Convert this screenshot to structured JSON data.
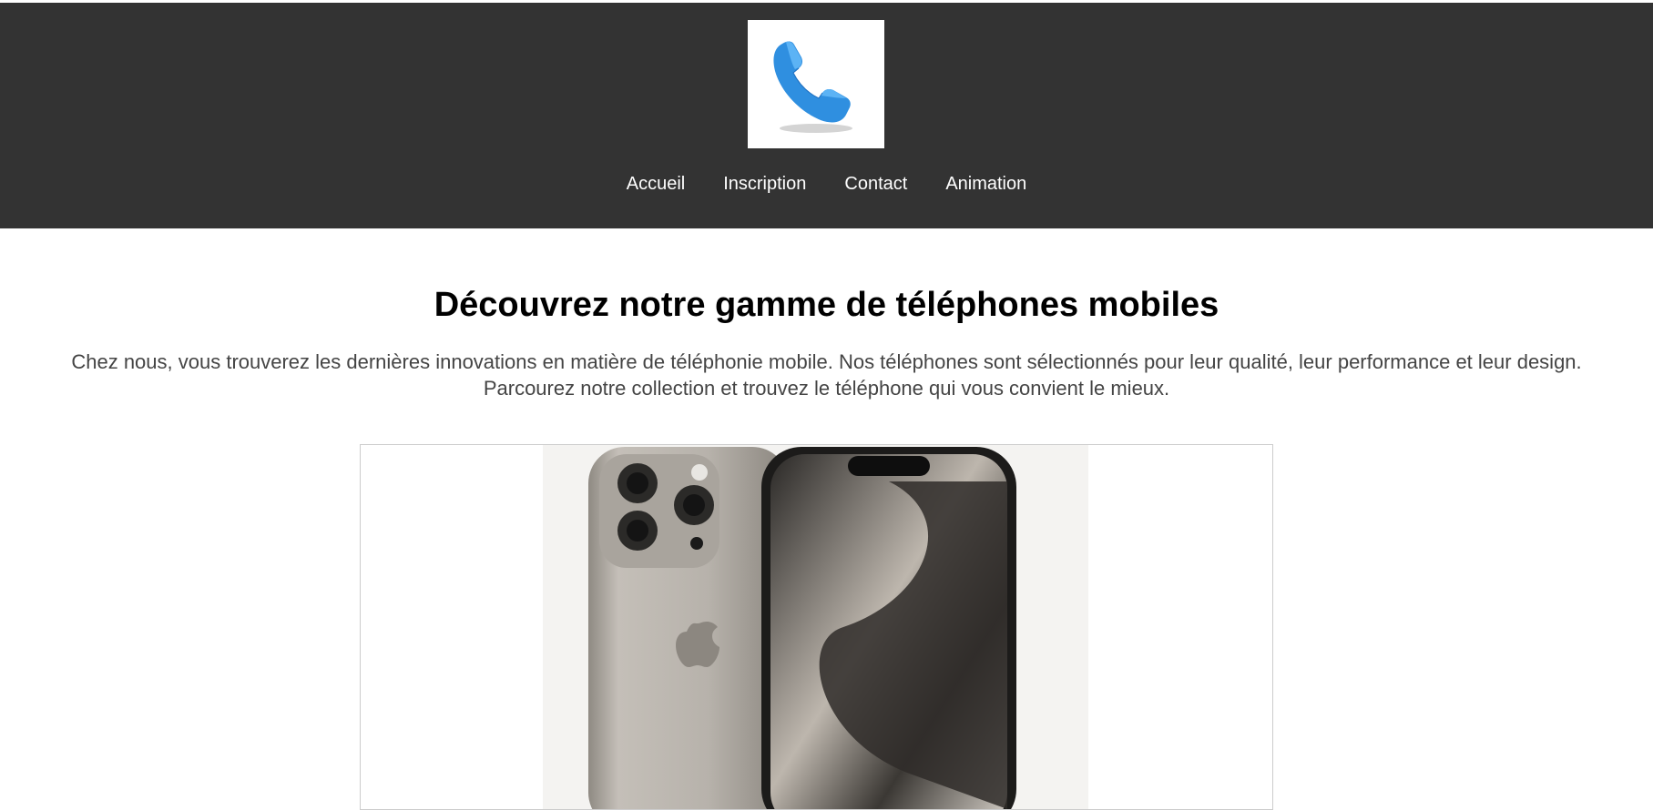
{
  "header": {
    "logo_icon": "phone-icon",
    "nav": [
      {
        "label": "Accueil"
      },
      {
        "label": "Inscription"
      },
      {
        "label": "Contact"
      },
      {
        "label": "Animation"
      }
    ]
  },
  "main": {
    "title": "Découvrez notre gamme de téléphones mobiles",
    "intro": "Chez nous, vous trouverez les dernières innovations en matière de téléphonie mobile. Nos téléphones sont sélectionnés pour leur qualité, leur performance et leur design. Parcourez notre collection et trouvez le téléphone qui vous convient le mieux."
  },
  "colors": {
    "header_bg": "#333333",
    "logo_blue": "#2f8fe0",
    "text_dark": "#000000",
    "text_body": "#444444"
  }
}
